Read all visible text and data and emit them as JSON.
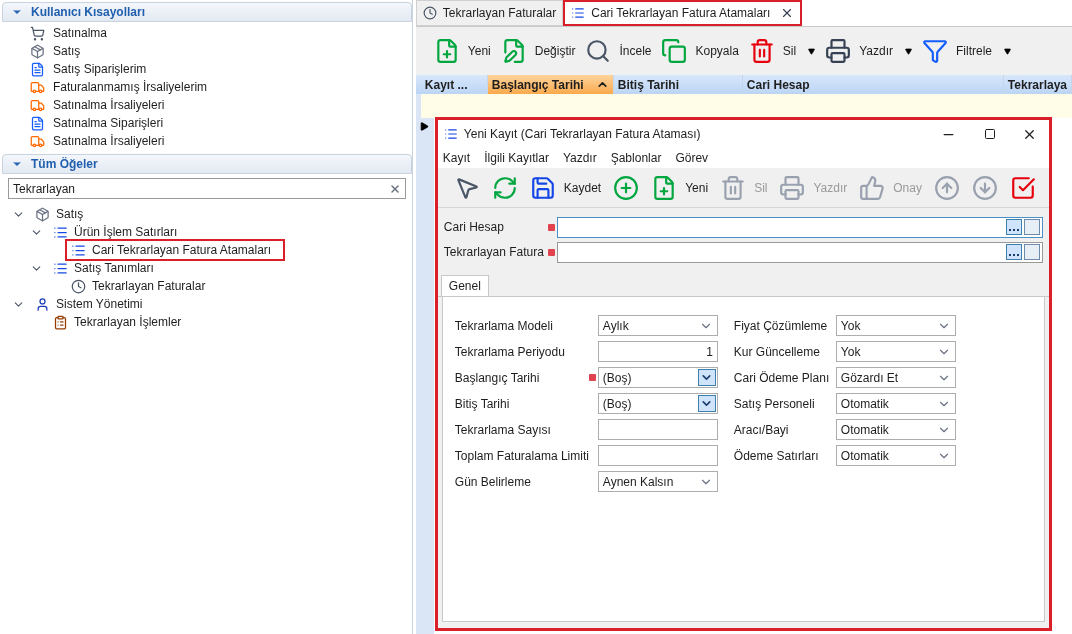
{
  "shortcuts": {
    "title": "Kullanıcı Kısayolları",
    "expanded": true,
    "items": [
      {
        "label": "Satınalma",
        "kind": "purchase"
      },
      {
        "label": "Satış",
        "kind": "sales"
      },
      {
        "label": "Satış Siparişlerim",
        "kind": "order"
      },
      {
        "label": "Faturalanmamış İrsaliyelerim",
        "kind": "shipment"
      },
      {
        "label": "Satınalma İrsaliyeleri",
        "kind": "shipment"
      },
      {
        "label": "Satınalma Siparişleri",
        "kind": "order"
      },
      {
        "label": "Satınalma İrsaliyeleri",
        "kind": "shipment"
      }
    ]
  },
  "all_items": {
    "title": "Tüm Öğeler",
    "expanded": true,
    "search": {
      "value": "Tekrarlayan"
    },
    "tree": [
      {
        "label": "Satış",
        "kind": "module",
        "expanded": true,
        "highlighted": false,
        "children": [
          {
            "label": "Ürün İşlem Satırları",
            "kind": "list",
            "expanded": true,
            "highlighted": false,
            "children": [
              {
                "label": "Cari Tekrarlayan Fatura Atamaları",
                "kind": "list",
                "highlighted": true
              }
            ]
          },
          {
            "label": "Satış Tanımları",
            "kind": "list",
            "expanded": true,
            "highlighted": false,
            "children": [
              {
                "label": "Tekrarlayan Faturalar",
                "kind": "clock",
                "highlighted": false
              }
            ]
          }
        ]
      },
      {
        "label": "Sistem Yönetimi",
        "kind": "admin",
        "expanded": true,
        "highlighted": false,
        "children": [
          {
            "label": "Tekrarlayan İşlemler",
            "kind": "task",
            "highlighted": false
          }
        ]
      }
    ]
  },
  "tabs": [
    {
      "label": "Tekrarlayan Faturalar",
      "kind": "clock",
      "selected": false,
      "closable": false,
      "highlighted": false
    },
    {
      "label": "Cari Tekrarlayan Fatura Atamaları",
      "kind": "list",
      "selected": true,
      "closable": true,
      "highlighted": true
    }
  ],
  "toolbar": [
    {
      "label": "Yeni",
      "kind": "new",
      "dropdown": false
    },
    {
      "label": "Değiştir",
      "kind": "edit",
      "dropdown": false
    },
    {
      "label": "İncele",
      "kind": "inspect",
      "dropdown": false
    },
    {
      "label": "Kopyala",
      "kind": "copy",
      "dropdown": false
    },
    {
      "label": "Sil",
      "kind": "delete",
      "dropdown": true
    },
    {
      "label": "Yazdır",
      "kind": "print",
      "dropdown": true
    },
    {
      "label": "Filtrele",
      "kind": "filter",
      "dropdown": true
    }
  ],
  "grid": {
    "columns": [
      {
        "label": "Kayıt ...",
        "sorted": false
      },
      {
        "label": "Başlangıç Tarihi",
        "sorted": true
      },
      {
        "label": "Bitiş Tarihi",
        "sorted": false
      },
      {
        "label": "Cari Hesap",
        "sorted": false
      },
      {
        "label": "Tekrarlaya",
        "sorted": false
      }
    ]
  },
  "dialog": {
    "title": "Yeni Kayıt (Cari Tekrarlayan Fatura Ataması)",
    "highlighted": true,
    "menu": [
      "Kayıt",
      "İlgili Kayıtlar",
      "Yazdır",
      "Şablonlar",
      "Görev"
    ],
    "toolbar": [
      {
        "kind": "new-pointer",
        "disabled": false
      },
      {
        "kind": "save-refresh",
        "disabled": false
      },
      {
        "kind": "save",
        "label": "Kaydet",
        "disabled": false
      },
      {
        "kind": "save-add",
        "disabled": false
      },
      {
        "kind": "new",
        "label": "Yeni",
        "disabled": false
      },
      {
        "kind": "delete",
        "label": "Sil",
        "disabled": true
      },
      {
        "kind": "print",
        "label": "Yazdır",
        "disabled": true
      },
      {
        "kind": "approve",
        "label": "Onay",
        "disabled": true
      },
      {
        "kind": "up",
        "disabled": true
      },
      {
        "kind": "down",
        "disabled": true
      },
      {
        "kind": "check",
        "disabled": false
      }
    ],
    "lookups": [
      {
        "label": "Cari Hesap",
        "required": true,
        "focused": true
      },
      {
        "label": "Tekrarlayan Fatura",
        "required": true,
        "focused": false
      }
    ],
    "tabs": [
      {
        "label": "Genel",
        "selected": true
      }
    ],
    "form_left": [
      {
        "label": "Tekrarlama Modeli",
        "kind": "combo",
        "value": "Aylık",
        "required": false
      },
      {
        "label": "Tekrarlama Periyodu",
        "kind": "number",
        "value": "1",
        "required": false
      },
      {
        "label": "Başlangıç Tarihi",
        "kind": "date",
        "value": "(Boş)",
        "required": true
      },
      {
        "label": "Bitiş Tarihi",
        "kind": "date",
        "value": "(Boş)",
        "required": false
      },
      {
        "label": "Tekrarlama Sayısı",
        "kind": "text",
        "required": false
      },
      {
        "label": "Toplam Faturalama Limiti",
        "kind": "text",
        "required": false
      },
      {
        "label": "Gün Belirleme",
        "kind": "combo",
        "value": "Aynen Kalsın",
        "required": false
      }
    ],
    "form_right": [
      {
        "label": "Fiyat Çözümleme",
        "kind": "combo",
        "value": "Yok"
      },
      {
        "label": "Kur Güncelleme",
        "kind": "combo",
        "value": "Yok"
      },
      {
        "label": "Cari Ödeme Planı",
        "kind": "combo",
        "value": "Gözardı Et"
      },
      {
        "label": "Satış Personeli",
        "kind": "combo",
        "value": "Otomatik"
      },
      {
        "label": "Aracı/Bayi",
        "kind": "combo",
        "value": "Otomatik"
      },
      {
        "label": "Ödeme Satırları",
        "kind": "combo",
        "value": "Otomatik"
      }
    ]
  }
}
